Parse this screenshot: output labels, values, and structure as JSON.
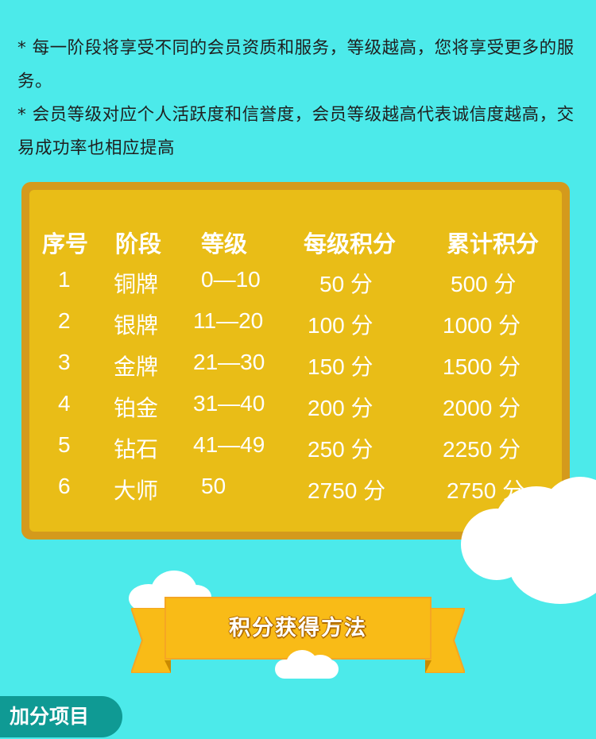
{
  "intro": {
    "line1": "* 每一阶段将享受不同的会员资质和服务，等级越高，您将享受更多的服务。",
    "line2": "* 会员等级对应个人活跃度和信誉度，会员等级越高代表诚信度越高，交易成功率也相应提高"
  },
  "table": {
    "headers": [
      "序号",
      "阶段",
      "等级",
      "每级积分",
      "累计积分"
    ],
    "rows": [
      [
        "1",
        "铜牌",
        "0—10",
        "50 分",
        "500 分"
      ],
      [
        "2",
        "银牌",
        "11—20",
        "100 分",
        "1000 分"
      ],
      [
        "3",
        "金牌",
        "21—30",
        "150 分",
        "1500 分"
      ],
      [
        "4",
        "铂金",
        "31—40",
        "200 分",
        "2000 分"
      ],
      [
        "5",
        "钻石",
        "41—49",
        "250 分",
        "2250 分"
      ],
      [
        "6",
        "大师",
        "50",
        "2750 分",
        "2750 分"
      ]
    ]
  },
  "banner": {
    "title": "积分获得方法"
  },
  "section": {
    "title": "加分项目"
  },
  "colors": {
    "background": "#4ceaea",
    "board_border": "#d49a1c",
    "board_fill": "#e9bd17",
    "ribbon": "#f9bb17",
    "section_tag": "#0f9a94"
  }
}
